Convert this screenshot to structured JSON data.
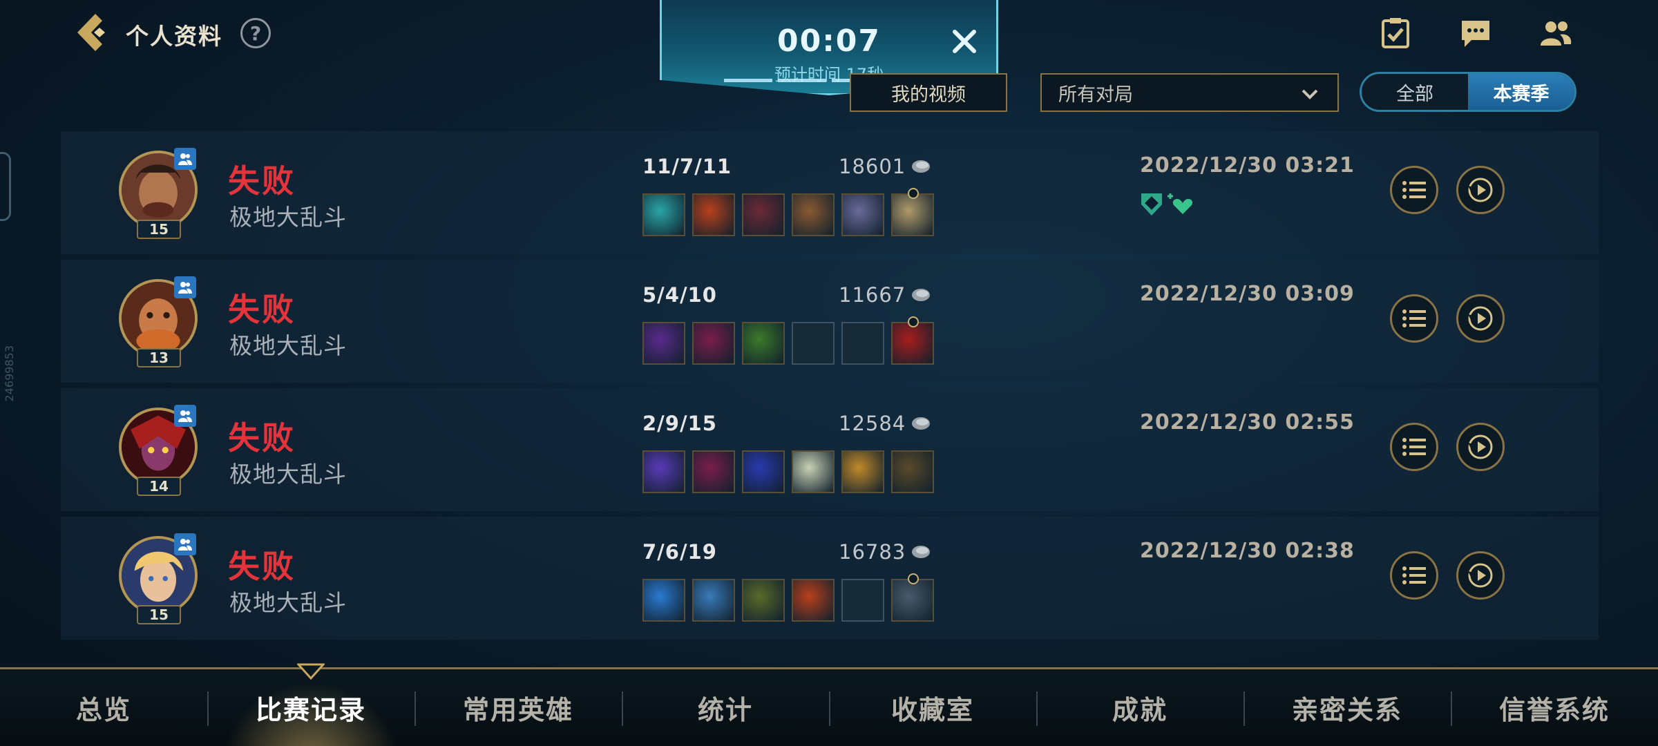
{
  "header": {
    "title": "个人资料",
    "help_glyph": "?",
    "icons": [
      "checklist-icon",
      "chat-icon",
      "friends-icon"
    ]
  },
  "queue": {
    "time": "00:07",
    "estimate": "预计时间 17秒",
    "close_glyph": "✕"
  },
  "filters": {
    "video_button": "我的视频",
    "match_filter": "所有对局",
    "segment": [
      "全部",
      "本赛季"
    ],
    "segment_active": "本赛季"
  },
  "matches": [
    {
      "result": "失败",
      "mode": "极地大乱斗",
      "level": "15",
      "kda": "11/7/11",
      "gold": "18601",
      "date": "2022/12/30 03:21",
      "items": [
        "#2aa6a8",
        "#b8401c",
        "#6b2a36",
        "#8a5a32",
        "#6a6a9a",
        "#b09a6a"
      ]
    },
    {
      "result": "失败",
      "mode": "极地大乱斗",
      "level": "13",
      "kda": "5/4/10",
      "gold": "11667",
      "date": "2022/12/30 03:09",
      "items": [
        "#5a2a8c",
        "#7a1e4a",
        "#3c7a2a",
        "",
        "",
        "#a81e1e"
      ]
    },
    {
      "result": "失败",
      "mode": "极地大乱斗",
      "level": "14",
      "kda": "2/9/15",
      "gold": "12584",
      "date": "2022/12/30 02:55",
      "items": [
        "#5a3ab8",
        "#7a1e4a",
        "#2a3ab0",
        "#c8d0b4",
        "#c08a2a",
        "#5a4a2a"
      ]
    },
    {
      "result": "失败",
      "mode": "极地大乱斗",
      "level": "15",
      "kda": "7/6/19",
      "gold": "16783",
      "date": "2022/12/30 02:38",
      "items": [
        "#2a7ad0",
        "#3a7ab8",
        "#5a6a2a",
        "#b8401c",
        "",
        "#4a5a6a"
      ]
    }
  ],
  "nav": {
    "tabs": [
      "总览",
      "比赛记录",
      "常用英雄",
      "统计",
      "收藏室",
      "成就",
      "亲密关系",
      "信誉系统"
    ],
    "active": "比赛记录"
  },
  "side_id": "24699853"
}
